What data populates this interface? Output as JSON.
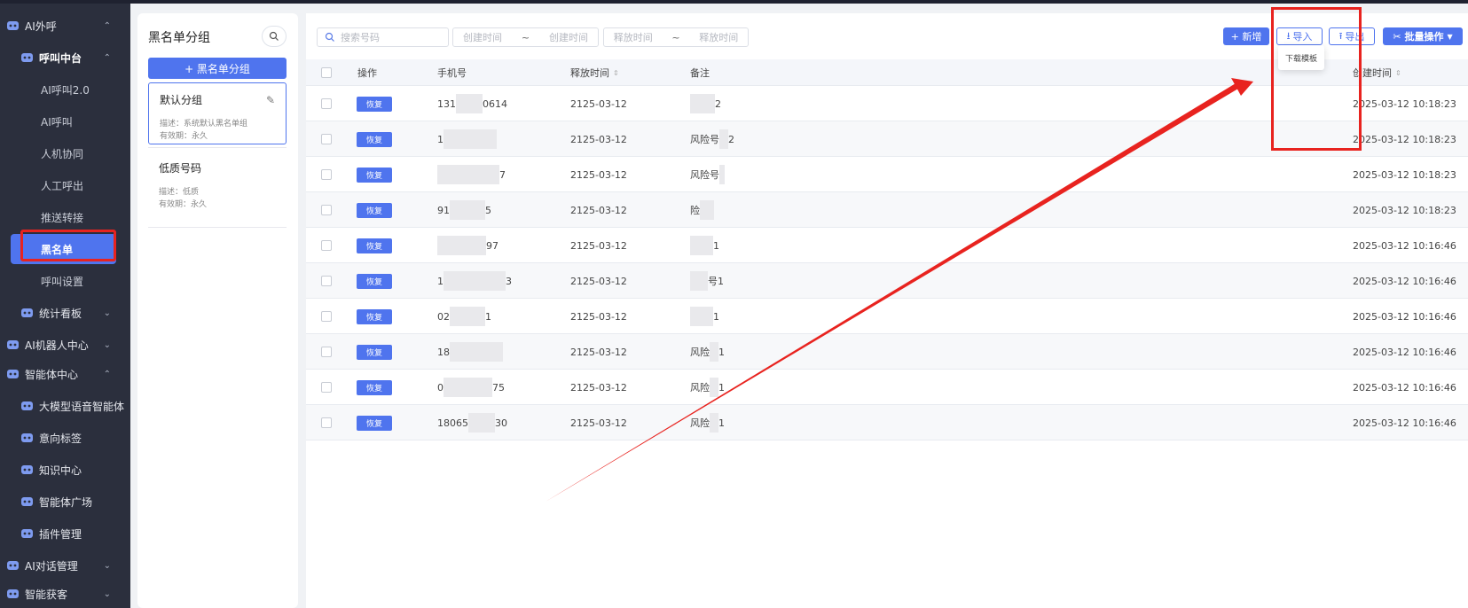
{
  "sidebar": {
    "items": [
      {
        "label": "AI外呼",
        "chevron": "^",
        "icon": "phone-robot-icon"
      },
      {
        "label": "呼叫中台",
        "chevron": "^",
        "icon": "call-center-icon"
      },
      {
        "label": "AI呼叫2.0"
      },
      {
        "label": "AI呼叫"
      },
      {
        "label": "人机协同"
      },
      {
        "label": "人工呼出"
      },
      {
        "label": "推送转接"
      },
      {
        "label": "黑名单"
      },
      {
        "label": "呼叫设置"
      },
      {
        "label": "统计看板",
        "chevron": "v",
        "icon": "chart-icon"
      },
      {
        "label": "AI机器人中心",
        "chevron": "v",
        "icon": "robot-icon"
      },
      {
        "label": "智能体中心",
        "chevron": "^",
        "icon": "agent-icon"
      },
      {
        "label": "大模型语音智能体",
        "icon": "model-icon"
      },
      {
        "label": "意向标签",
        "icon": "tag-icon"
      },
      {
        "label": "知识中心",
        "icon": "knowledge-icon"
      },
      {
        "label": "智能体广场",
        "icon": "square-icon"
      },
      {
        "label": "插件管理",
        "icon": "plugin-icon"
      },
      {
        "label": "AI对话管理",
        "chevron": "v",
        "icon": "dialog-icon"
      },
      {
        "label": "智能获客",
        "chevron": "v",
        "icon": "customer-icon"
      }
    ]
  },
  "groups": {
    "title": "黑名单分组",
    "add_label": "+ 黑名单分组",
    "items": [
      {
        "name": "默认分组",
        "desc": "描述：系统默认黑名单组",
        "validity": "有效期：永久"
      },
      {
        "name": "低质号码",
        "desc": "描述：低质",
        "validity": "有效期：永久"
      }
    ]
  },
  "toolbar": {
    "search_placeholder": "搜索号码",
    "create_start": "创建时间",
    "create_end": "创建时间",
    "release_start": "释放时间",
    "release_end": "释放时间",
    "range_sep": "~",
    "add_label": "+ 新增",
    "import_label": "导入",
    "export_label": "导出",
    "batch_label": "批量操作",
    "dropdown_item": "下载模板"
  },
  "table": {
    "headers": {
      "action": "操作",
      "phone": "手机号",
      "release": "释放时间",
      "remark": "备注",
      "created": "创建时间"
    },
    "restore_label": "恢复",
    "rows": [
      {
        "phone_a": "131",
        "phone_b": "0614",
        "release": "2125-03-12",
        "remark_a": "",
        "remark_b": "2",
        "created": "2025-03-12 10:18:23"
      },
      {
        "phone_a": "1",
        "phone_b": "",
        "release": "2125-03-12",
        "remark_a": "风险号",
        "remark_b": "2",
        "created": "2025-03-12 10:18:23"
      },
      {
        "phone_a": "",
        "phone_b": "7",
        "release": "2125-03-12",
        "remark_a": "风险号",
        "remark_b": "",
        "created": "2025-03-12 10:18:23"
      },
      {
        "phone_a": "91",
        "phone_b": "5",
        "release": "2125-03-12",
        "remark_a": "险",
        "remark_b": "",
        "created": "2025-03-12 10:18:23"
      },
      {
        "phone_a": "",
        "phone_b": "97",
        "release": "2125-03-12",
        "remark_a": "",
        "remark_b": "1",
        "created": "2025-03-12 10:16:46"
      },
      {
        "phone_a": "1",
        "phone_b": "3",
        "release": "2125-03-12",
        "remark_a": "",
        "remark_b": "号1",
        "created": "2025-03-12 10:16:46"
      },
      {
        "phone_a": "02",
        "phone_b": "1",
        "release": "2125-03-12",
        "remark_a": "",
        "remark_b": "1",
        "created": "2025-03-12 10:16:46"
      },
      {
        "phone_a": "18",
        "phone_b": "",
        "release": "2125-03-12",
        "remark_a": "风险",
        "remark_b": "1",
        "created": "2025-03-12 10:16:46"
      },
      {
        "phone_a": "0",
        "phone_b": "75",
        "release": "2125-03-12",
        "remark_a": "风险",
        "remark_b": "1",
        "created": "2025-03-12 10:16:46"
      },
      {
        "phone_a": "18065",
        "phone_b": "30",
        "release": "2125-03-12",
        "remark_a": "风险",
        "remark_b": "1",
        "created": "2025-03-12 10:16:46"
      }
    ]
  },
  "colors": {
    "accent": "#4f74ee",
    "annotation": "#e8231f",
    "sidebar_bg": "#2b2f3d"
  }
}
